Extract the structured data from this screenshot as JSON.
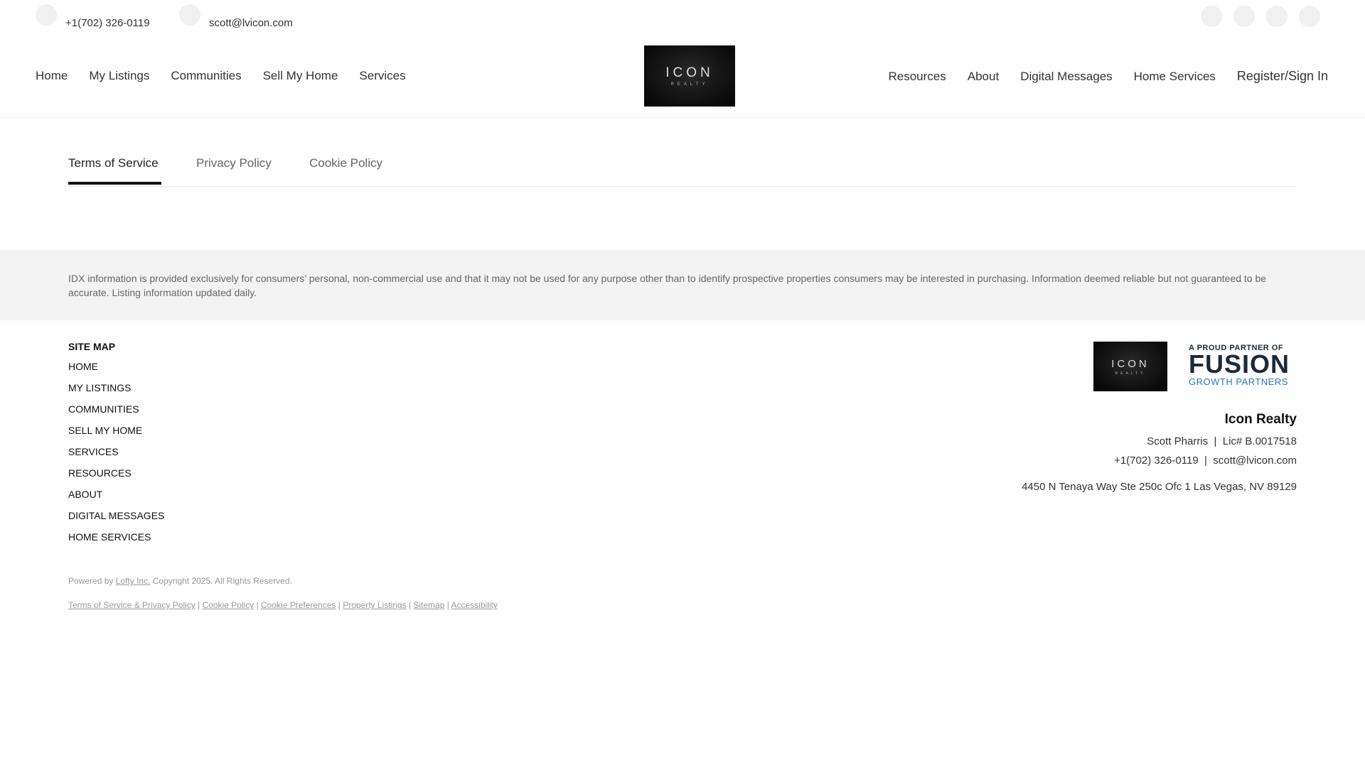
{
  "topbar": {
    "phone": "+1(702) 326-0119",
    "email": "scott@lvicon.com",
    "social_icons": [
      "social-icon-1",
      "social-icon-2",
      "social-icon-3",
      "social-icon-4"
    ]
  },
  "nav": {
    "left": [
      "Home",
      "My Listings",
      "Communities",
      "Sell My Home",
      "Services"
    ],
    "right": [
      "Resources",
      "About",
      "Digital Messages",
      "Home Services"
    ],
    "register": "Register/Sign In",
    "logo_main": "ICON",
    "logo_sub": "REALTY"
  },
  "tabs": [
    "Terms of Service",
    "Privacy Policy",
    "Cookie Policy"
  ],
  "disclaimer": "IDX information is provided exclusively for consumers’ personal, non-commercial use and that it may not be used for any purpose other than to identify prospective properties consumers may be interested in purchasing. Information deemed reliable but not guaranteed to be accurate. Listing information updated daily.",
  "footer": {
    "sitemap_title": "SITE MAP",
    "sitemap": [
      "HOME",
      "MY LISTINGS",
      "COMMUNITIES",
      "SELL MY HOME",
      "SERVICES",
      "RESOURCES",
      "ABOUT",
      "DIGITAL MESSAGES",
      "HOME SERVICES"
    ],
    "powered_prefix": "Powered by",
    "powered_link": "Lofty Inc.",
    "powered_suffix": "Copyright 2025. All Rights Reserved.",
    "links": [
      "Terms of Service & Privacy Policy",
      "Cookie Policy",
      "Cookie Preferences",
      "Property Listings",
      "Sitemap",
      "Accessibility"
    ],
    "logo_main": "ICON",
    "logo_sub": "REALTY",
    "fusion_top": "A PROUD PARTNER OF",
    "fusion_main": "FUSION",
    "fusion_bottom": "GROWTH PARTNERS",
    "company": "Icon Realty",
    "agent": "Scott Pharris",
    "license": "Lic# B.0017518",
    "phone": "+1(702) 326-0119",
    "email": "scott@lvicon.com",
    "address": "4450 N Tenaya Way Ste 250c Ofc 1 Las Vegas, NV 89129"
  }
}
